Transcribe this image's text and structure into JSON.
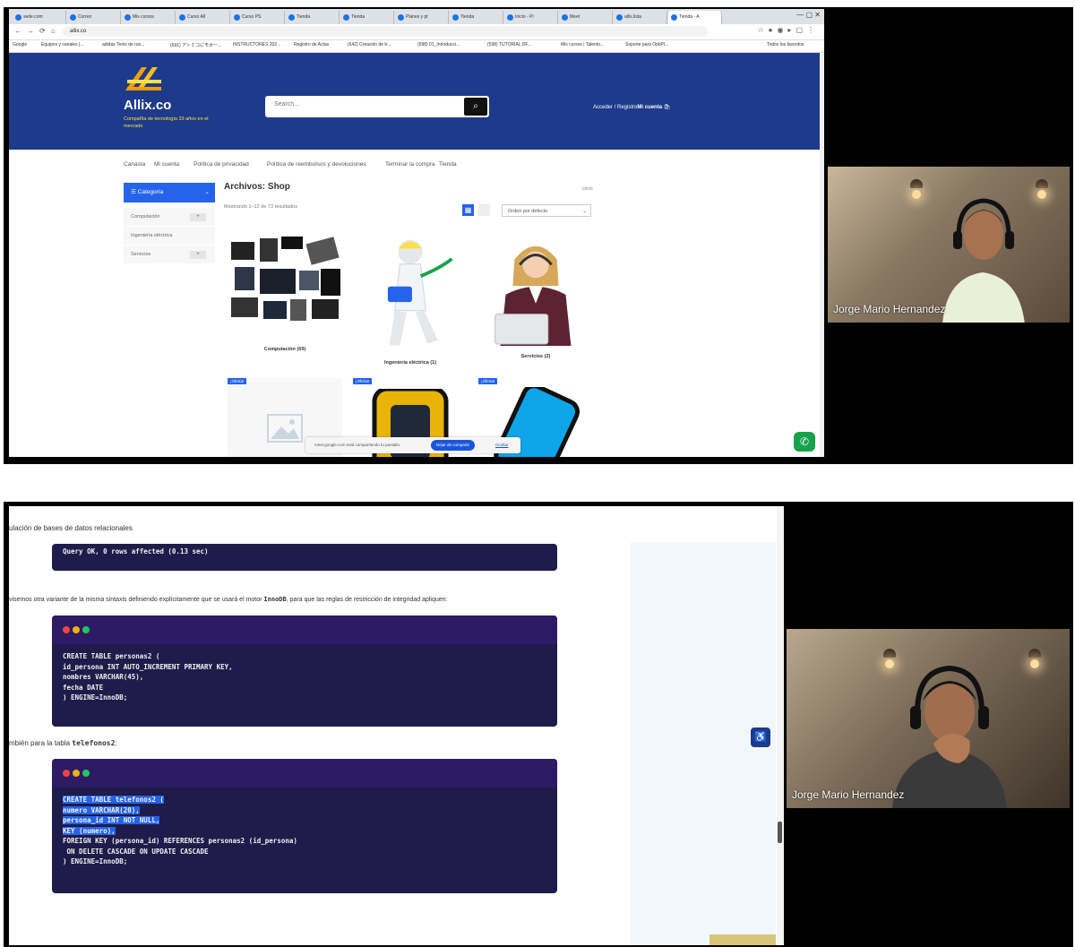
{
  "browser": {
    "tabs": [
      "sede.com",
      "Correo",
      "Mis cursos",
      "Curso All",
      "Curso PS",
      "Tienda",
      "Tienda",
      "Planes y pl",
      "Tienda",
      "Inicio - Pl",
      "Meet",
      "allix.lista",
      "Tienda - A"
    ],
    "url": "allix.co",
    "window_controls": "—  ▢  ✕",
    "bookmarks": [
      "Google",
      "Equipos y canales |...",
      "adidas Tenis de run...",
      "(691) アトミコにモボー...",
      "INSTRUCTORES 202...",
      "Registro de Actas",
      "(642) Creación de b...",
      "(598) 01_Introducci...",
      "(598) TUTORIAL DF...",
      "Mis cursos | Talento...",
      "Soporte para OptiPl...",
      "Todos los favoritos"
    ]
  },
  "site": {
    "logo_text": "Allix.co",
    "tagline": "Compañía de tecnología 33 años en el mercado",
    "search_placeholder": "Search...",
    "account_prefix": "Acceder / Registro",
    "account_label": "Mi cuenta",
    "nav": [
      "Canasta",
      "Mi cuenta",
      "Política de privacidad",
      "Política de reembolsos y devoluciones",
      "Terminar la compra",
      "Tienda"
    ],
    "category_header": "Categoría",
    "categories": [
      "Computación",
      "Ingeniería eléctrica",
      "Servicios"
    ],
    "archive_title": "Archivos: Shop",
    "breadcrumb": "Inicio",
    "result_count": "Mostrando 1–12 de 73 resultados",
    "orderby": "Orden por defecto",
    "products": [
      {
        "caption": "Computación (69)"
      },
      {
        "caption": "Ingeniería eléctrica (1)"
      },
      {
        "caption": "Servicios (2)"
      }
    ],
    "offer_label": "¡Oferta!",
    "share_text": "meet.google.com está compartiendo tu pantalla.",
    "stop_share": "Dejar de compartir",
    "hide_share": "Ocultar"
  },
  "video_top": {
    "name": "Jorge Mario Hernandez"
  },
  "doc": {
    "line1": "ulación de bases de datos relacionales",
    "code1": "Query OK, 0 rows affected (0.13 sec)",
    "para1_prefix": "visemos otra variante de la misma sintaxis definiendo explícitamente que se usará el motor ",
    "para1_code": "InnoDB",
    "para1_suffix": ", para que las reglas de restricción de integridad apliquen:",
    "code2": [
      "CREATE TABLE personas2 (",
      "id_persona INT AUTO_INCREMENT PRIMARY KEY,",
      "nombres VARCHAR(45),",
      "fecha DATE",
      ") ENGINE=InnoDB;"
    ],
    "para2_prefix": "mbién para la tabla ",
    "para2_code": "telefonos2",
    "para2_suffix": ":",
    "code3": [
      "CREATE TABLE telefonos2 (",
      "numero VARCHAR(20),",
      "persona_id INT NOT NULL,",
      "KEY (numero),",
      "FOREIGN KEY (persona_id) REFERENCES personas2 (id_persona)",
      " ON DELETE CASCADE ON UPDATE CASCADE",
      ") ENGINE=InnoDB;"
    ],
    "code3_highlight_lines": 4
  },
  "video_bottom": {
    "name": "Jorge Mario Hernandez"
  },
  "colors": {
    "site_header": "#1e3a8a",
    "accent": "#2563eb",
    "code_bg": "#1f1b4a",
    "code_head": "#2d1b66",
    "dot_red": "#ef4444",
    "dot_yellow": "#eab308",
    "dot_green": "#22c55e"
  }
}
